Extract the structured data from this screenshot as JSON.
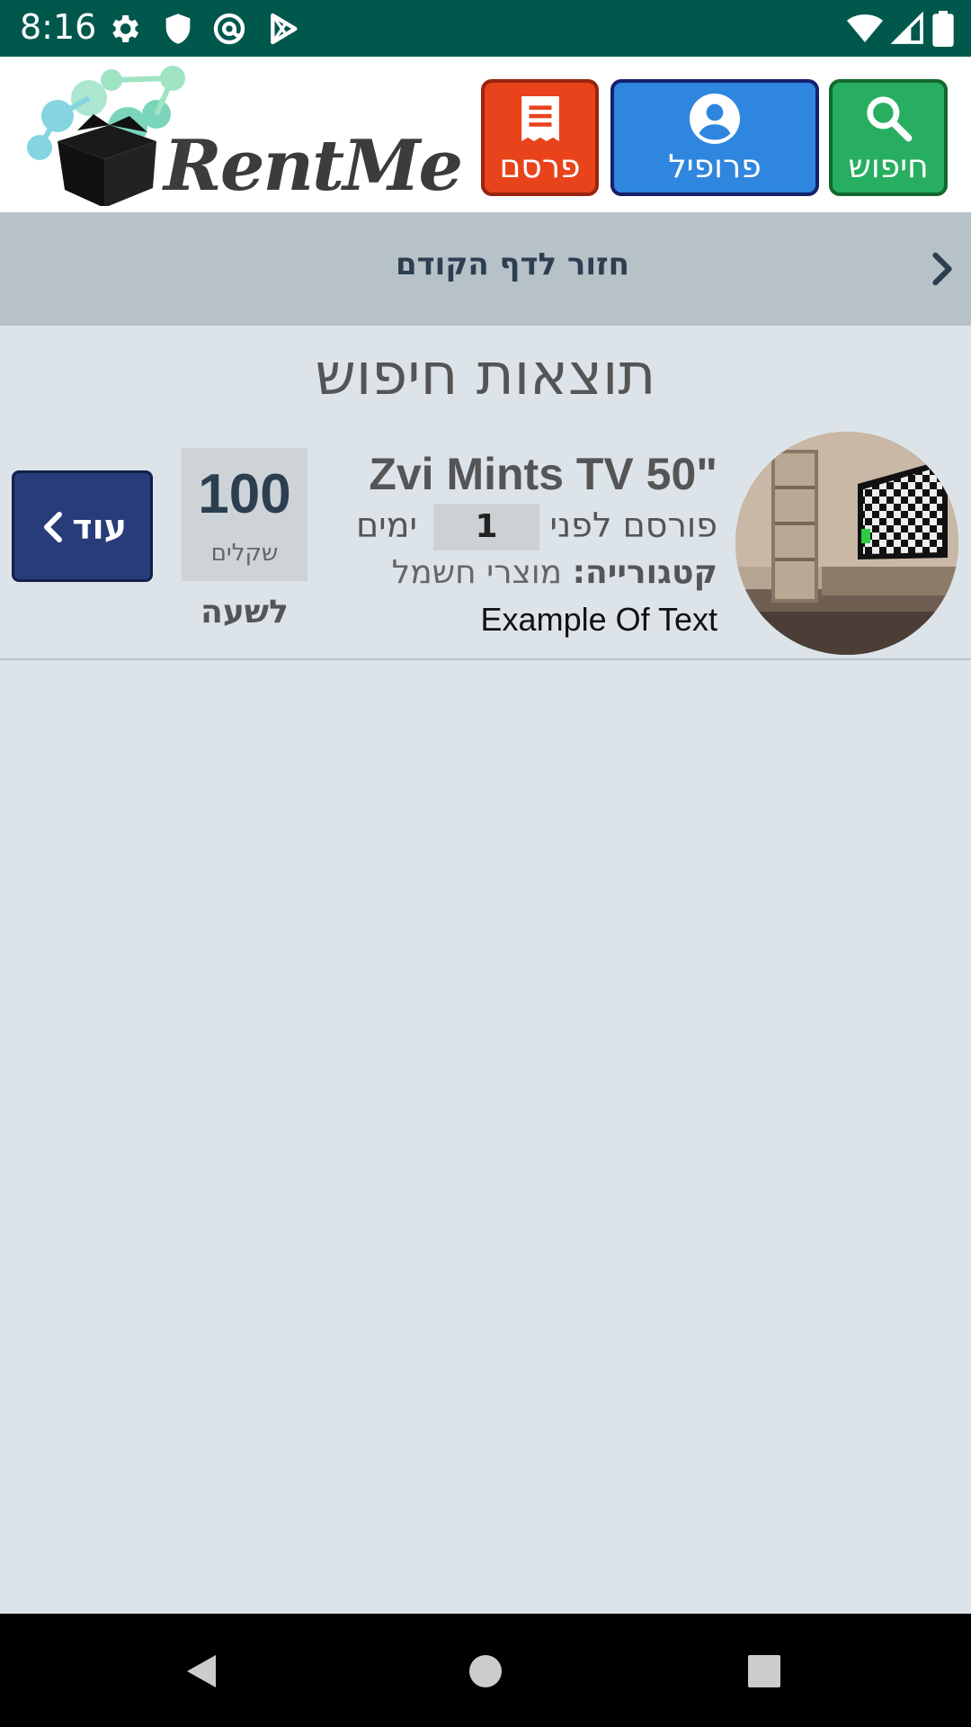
{
  "status_bar": {
    "time": "8:16",
    "left_icons": [
      "gear-icon",
      "shield-icon",
      "at-sign-icon",
      "play-store-icon"
    ],
    "right_icons": [
      "wifi-icon",
      "signal-icon",
      "battery-icon"
    ]
  },
  "header": {
    "logo_text": "RentMe",
    "buttons": [
      {
        "label": "פרסם",
        "icon": "receipt-icon",
        "color": "#e8431b"
      },
      {
        "label": "פרופיל",
        "icon": "account-circle-icon",
        "color": "#2e86de"
      },
      {
        "label": "חיפוש",
        "icon": "search-icon",
        "color": "#27ae60"
      }
    ]
  },
  "back_bar": {
    "label": "חזור לדף הקודם",
    "icon": "chevron-right-icon"
  },
  "page": {
    "title": "תוצאות חיפוש"
  },
  "results": [
    {
      "title": "Zvi Mints TV 50\"",
      "posted_prefix": "פורסם לפני",
      "posted_days": "1",
      "posted_suffix": "ימים",
      "category_label": "קטגורייה:",
      "category_value": "מוצרי חשמל",
      "description": "Example Of Text",
      "price": "100",
      "currency": "שקלים",
      "per": "לשעה",
      "more_label": "עוד"
    }
  ],
  "nav_bar": {
    "icons": [
      "back-triangle-icon",
      "home-circle-icon",
      "recents-square-icon"
    ]
  }
}
